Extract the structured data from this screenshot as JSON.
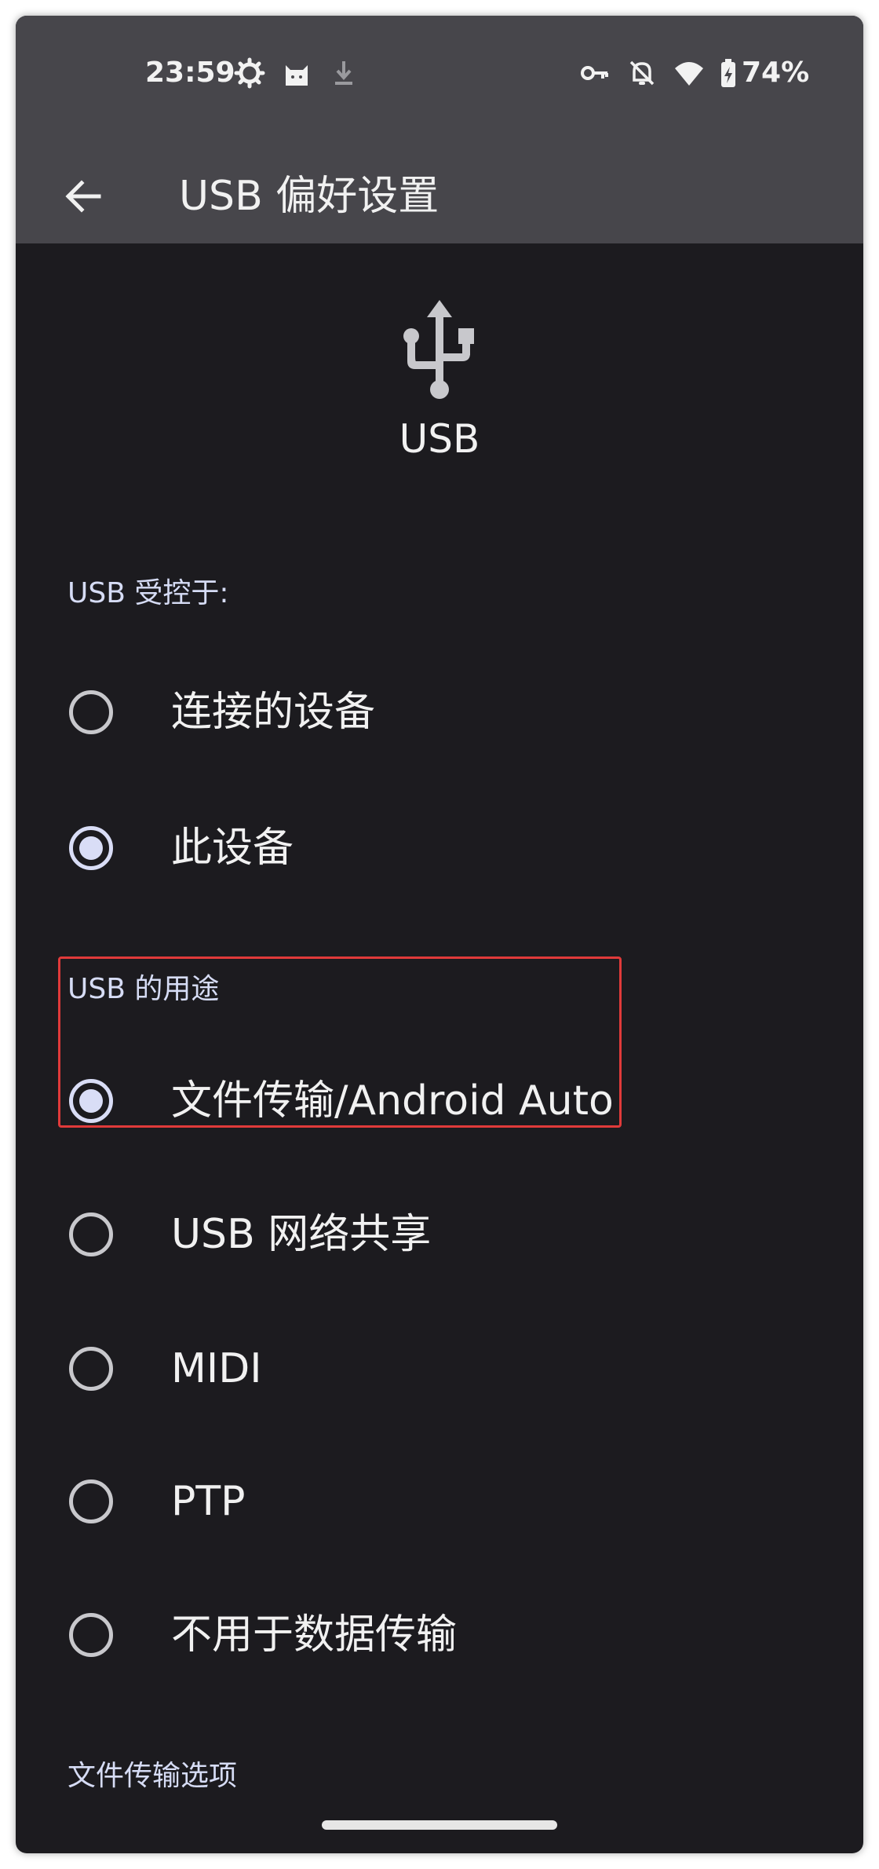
{
  "status_bar": {
    "time": "23:59",
    "battery_percent": "74%",
    "icons_left": [
      "settings-gear-icon",
      "cat-app-icon",
      "download-icon"
    ],
    "icons_right": [
      "vpn-key-icon",
      "notifications-off-icon",
      "wifi-icon",
      "battery-charging-icon"
    ]
  },
  "app_bar": {
    "back_icon": "arrow-back-icon",
    "title": "USB 偏好设置"
  },
  "hero": {
    "icon": "usb-icon",
    "label": "USB"
  },
  "controlled_by": {
    "header": "USB 受控于:",
    "options": [
      {
        "label": "连接的设备",
        "checked": false
      },
      {
        "label": "此设备",
        "checked": true
      }
    ]
  },
  "usage": {
    "header": "USB 的用途",
    "options": [
      {
        "label": "文件传输/Android Auto",
        "checked": true
      },
      {
        "label": "USB 网络共享",
        "checked": false
      },
      {
        "label": "MIDI",
        "checked": false
      },
      {
        "label": "PTP",
        "checked": false
      },
      {
        "label": "不用于数据传输",
        "checked": false
      }
    ]
  },
  "file_transfer_options": {
    "header": "文件传输选项"
  },
  "colors": {
    "background": "#1c1b1f",
    "topbar": "#47464b",
    "accent": "#d9ddf6",
    "highlight": "#e03a3a"
  }
}
